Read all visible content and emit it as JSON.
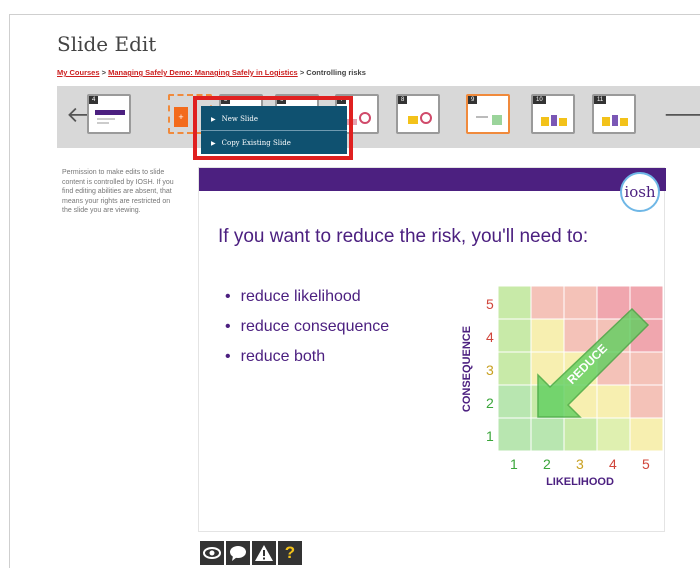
{
  "page": {
    "title": "Slide Edit"
  },
  "breadcrumb": {
    "items": [
      "My Courses",
      "Managing Safely Demo: Managing Safely in Logistics"
    ],
    "separator": ">",
    "current": "Controlling risks"
  },
  "slide_strip": {
    "prev_icon": "arrow-left-icon",
    "next_icon": "arrow-right-icon",
    "thumbnails": [
      "4",
      "5",
      "6",
      "7",
      "8",
      "9",
      "10",
      "11"
    ],
    "active": "9",
    "add_button_label": "+"
  },
  "context_menu": {
    "items": [
      "New Slide",
      "Copy Existing Slide"
    ],
    "highlight_color": "#e02020"
  },
  "sidenote": "Permission to make edits to slide content is controlled by IOSH. If you find editing abilities are absent, that means your rights are restricted on the slide you are viewing.",
  "slide": {
    "logo_text": "iosh",
    "heading": "If you want to reduce the risk, you'll need to:",
    "bullets": [
      "reduce likelihood",
      "reduce consequence",
      "reduce both"
    ],
    "brand_color": "#4c2080"
  },
  "matrix": {
    "y_label": "CONSEQUENCE",
    "x_label": "LIKELIHOOD",
    "y_ticks": [
      "1",
      "2",
      "3",
      "4",
      "5"
    ],
    "x_ticks": [
      "1",
      "2",
      "3",
      "4",
      "5"
    ],
    "arrow_label": "REDUCE"
  },
  "toolbar": {
    "icons": [
      "eye-icon",
      "comment-icon",
      "warning-icon",
      "help-icon"
    ],
    "help_label": "?"
  }
}
